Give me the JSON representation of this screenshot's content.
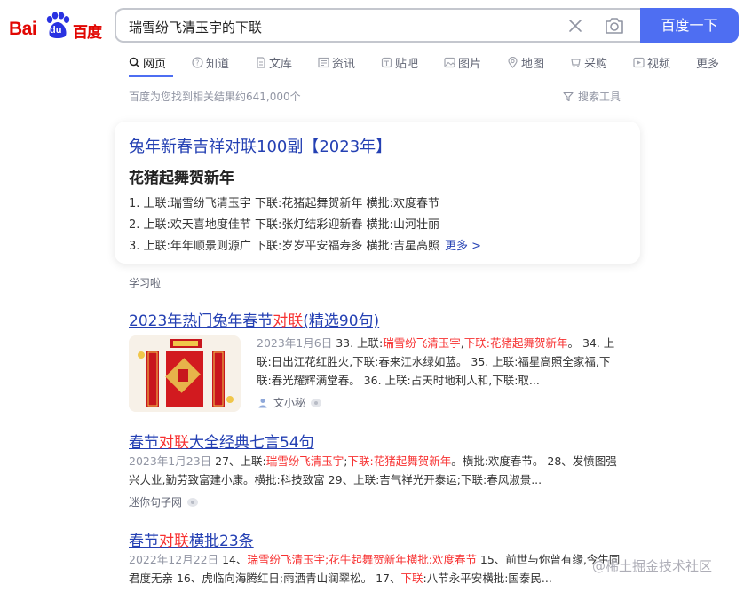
{
  "logo": {
    "bai": "Bai",
    "du": "du",
    "cn": "百度"
  },
  "search": {
    "query": "瑞雪纷飞清玉宇的下联",
    "button": "百度一下"
  },
  "tabs": [
    {
      "label": "网页",
      "icon": "search-icon"
    },
    {
      "label": "知道",
      "icon": "question-icon"
    },
    {
      "label": "文库",
      "icon": "doc-icon"
    },
    {
      "label": "资讯",
      "icon": "news-icon"
    },
    {
      "label": "贴吧",
      "icon": "tieba-icon"
    },
    {
      "label": "图片",
      "icon": "image-icon"
    },
    {
      "label": "地图",
      "icon": "map-icon"
    },
    {
      "label": "采购",
      "icon": "purchase-icon"
    },
    {
      "label": "视频",
      "icon": "video-icon"
    },
    {
      "label": "更多",
      "icon": ""
    }
  ],
  "result_count": "百度为您找到相关结果约641,000个",
  "tools_label": "搜索工具",
  "card": {
    "title": "兔年新春吉祥对联100副【2023年】",
    "subtitle": "花猪起舞贺新年",
    "lines": [
      "1. 上联:瑞雪纷飞清玉宇 下联:花猪起舞贺新年 横批:欢度春节",
      "2. 上联:欢天喜地度佳节 下联:张灯结彩迎新春 横批:山河壮丽",
      "3. 上联:年年顺景则源广 下联:岁岁平安福寿多 横批:吉星高照"
    ],
    "more": "更多 >",
    "source": "学习啦"
  },
  "results": [
    {
      "title_pre": "2023年热门兔年春节",
      "title_hl": "对联",
      "title_post": "(精选90句)",
      "date": "2023年1月6日",
      "snip_a": " 33. 上联:",
      "snip_hl1": "瑞雪纷飞清玉宇",
      "snip_b": ",",
      "snip_hl2": "下联:花猪起舞贺新年",
      "snip_c": "。 34. 上",
      "snip_line2": "联:日出江花红胜火,下联:春来江水绿如蓝。 35. 上联:福星高照全家福,下",
      "snip_line3": "联:春光耀辉满堂春。 36. 上联:占天时地利人和,下联:取...",
      "source": "文小秘"
    },
    {
      "title_pre": "春节",
      "title_hl": "对联",
      "title_post": "大全经典七言54句",
      "date": "2023年1月23日",
      "snip_a": " 27、上联:",
      "snip_hl1": "瑞雪纷飞清玉宇",
      "snip_b": ";",
      "snip_hl2": "下联:花猪起舞贺新年",
      "snip_c": "。横批:欢度春节。 28、发愤图强",
      "snip_line2": "兴大业,勤劳致富建小康。横批:科技致富 29、上联:吉气祥光开泰运;下联:春风淑景...",
      "source": "迷你句子网"
    },
    {
      "title_pre": "春节",
      "title_hl": "对联",
      "title_post": "横批23条",
      "date": "2022年12月22日",
      "snip_a": " 14、",
      "snip_hl1": "瑞雪纷飞清玉宇;花牛起舞贺新年横批:欢度春节",
      "snip_c": " 15、前世与你曾有缘,今生同",
      "snip_line2_a": "君度无亲 16、虎临向海腾红日;雨洒青山润翠松。 17、",
      "snip_line2_hl": "下联",
      "snip_line2_b": ":八节永平安横批:国泰民..."
    }
  ],
  "watermark": "@稀土掘金技术社区",
  "colors": {
    "brand_blue": "#4e6ef2",
    "link": "#2440b3",
    "highlight": "#f73131",
    "logo_red": "#e10602"
  }
}
